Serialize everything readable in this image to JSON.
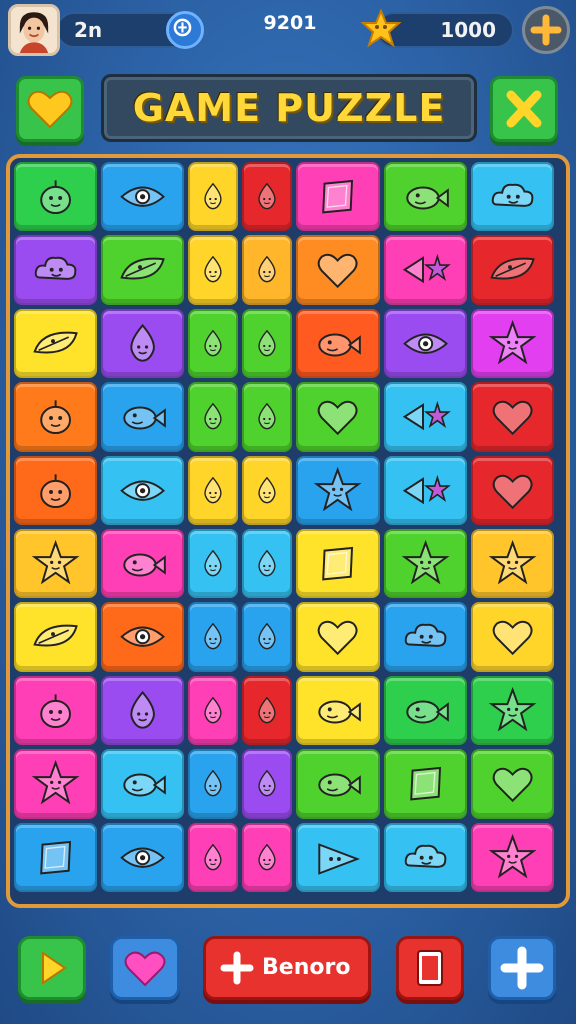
{
  "top_bar": {
    "level_label": "2n",
    "score": "9201",
    "coins": "1000"
  },
  "header": {
    "title": "GAME PUZZLE"
  },
  "board": {
    "columns": [
      {
        "w": 1
      },
      {
        "w": 1
      },
      {
        "w": 0.6
      },
      {
        "w": 0.6
      },
      {
        "w": 1
      },
      {
        "w": 1
      },
      {
        "w": 1
      }
    ],
    "rows": [
      [
        [
          "#2fcf4e",
          "blob"
        ],
        [
          "#2aa3ef",
          "eye"
        ],
        [
          "#ffd52a",
          "drop"
        ],
        [
          "#e6282c",
          "drop"
        ],
        [
          "#ff3fb6",
          "diamond"
        ],
        [
          "#4fd22d",
          "fish"
        ],
        [
          "#35c2f2",
          "cloud"
        ]
      ],
      [
        [
          "#9b4cf0",
          "cloud"
        ],
        [
          "#4fd22d",
          "leaf"
        ],
        [
          "#ffd52a",
          "drop"
        ],
        [
          "#ffb62a",
          "drop"
        ],
        [
          "#ff8c22",
          "heart"
        ],
        [
          "#ff3fb6",
          "triangle-star"
        ],
        [
          "#e6282c",
          "leaf"
        ]
      ],
      [
        [
          "#ffe22a",
          "leaf"
        ],
        [
          "#9b4cf0",
          "drop"
        ],
        [
          "#4fd22d",
          "drop"
        ],
        [
          "#4fd22d",
          "drop"
        ],
        [
          "#ff5a1f",
          "fish"
        ],
        [
          "#9b4cf0",
          "eye"
        ],
        [
          "#e13ff0",
          "star"
        ]
      ],
      [
        [
          "#ff7a1a",
          "blob"
        ],
        [
          "#2aa3ef",
          "fish"
        ],
        [
          "#4fd22d",
          "drop"
        ],
        [
          "#4fd22d",
          "drop"
        ],
        [
          "#4fd22d",
          "heart"
        ],
        [
          "#35c2f2",
          "triangle-star"
        ],
        [
          "#e6282c",
          "heart"
        ]
      ],
      [
        [
          "#ff6a1a",
          "blob"
        ],
        [
          "#35c2f2",
          "eye"
        ],
        [
          "#ffd52a",
          "drop"
        ],
        [
          "#ffd52a",
          "drop"
        ],
        [
          "#2aa3ef",
          "star"
        ],
        [
          "#35c2f2",
          "triangle-star"
        ],
        [
          "#e6282c",
          "heart"
        ]
      ],
      [
        [
          "#ffc52a",
          "star"
        ],
        [
          "#ff3fb6",
          "fish"
        ],
        [
          "#35c2f2",
          "drop"
        ],
        [
          "#35c2f2",
          "drop"
        ],
        [
          "#ffe22a",
          "diamond"
        ],
        [
          "#4fd22d",
          "star"
        ],
        [
          "#ffc52a",
          "star"
        ]
      ],
      [
        [
          "#ffe22a",
          "leaf"
        ],
        [
          "#ff6a1a",
          "eye"
        ],
        [
          "#2aa3ef",
          "drop"
        ],
        [
          "#2aa3ef",
          "drop"
        ],
        [
          "#ffe22a",
          "heart"
        ],
        [
          "#2aa3ef",
          "cloud"
        ],
        [
          "#ffd52a",
          "heart"
        ]
      ],
      [
        [
          "#ff3fb6",
          "blob"
        ],
        [
          "#9b4cf0",
          "drop"
        ],
        [
          "#ff3fb6",
          "drop"
        ],
        [
          "#e6282c",
          "drop"
        ],
        [
          "#ffe22a",
          "fish"
        ],
        [
          "#2fcf4e",
          "fish"
        ],
        [
          "#2fcf4e",
          "star"
        ]
      ],
      [
        [
          "#ff3fb6",
          "star"
        ],
        [
          "#35c2f2",
          "fish"
        ],
        [
          "#2aa3ef",
          "drop"
        ],
        [
          "#9b4cf0",
          "drop"
        ],
        [
          "#4fd22d",
          "fish"
        ],
        [
          "#4fd22d",
          "diamond"
        ],
        [
          "#4fd22d",
          "heart"
        ]
      ],
      [
        [
          "#2aa3ef",
          "diamond"
        ],
        [
          "#2aa3ef",
          "eye"
        ],
        [
          "#ff3fb6",
          "drop"
        ],
        [
          "#ff3fb6",
          "drop"
        ],
        [
          "#35c2f2",
          "triangle"
        ],
        [
          "#35c2f2",
          "cloud"
        ],
        [
          "#ff3fb6",
          "star"
        ]
      ]
    ]
  },
  "bottom_bar": {
    "main_button_label": "Benoro"
  },
  "colors": {
    "accent_yellow": "#ffd83a",
    "board_border": "#e09a3a",
    "green_button": "#38c44a",
    "red_button": "#e8322e",
    "blue_button": "#3d8ce0"
  }
}
